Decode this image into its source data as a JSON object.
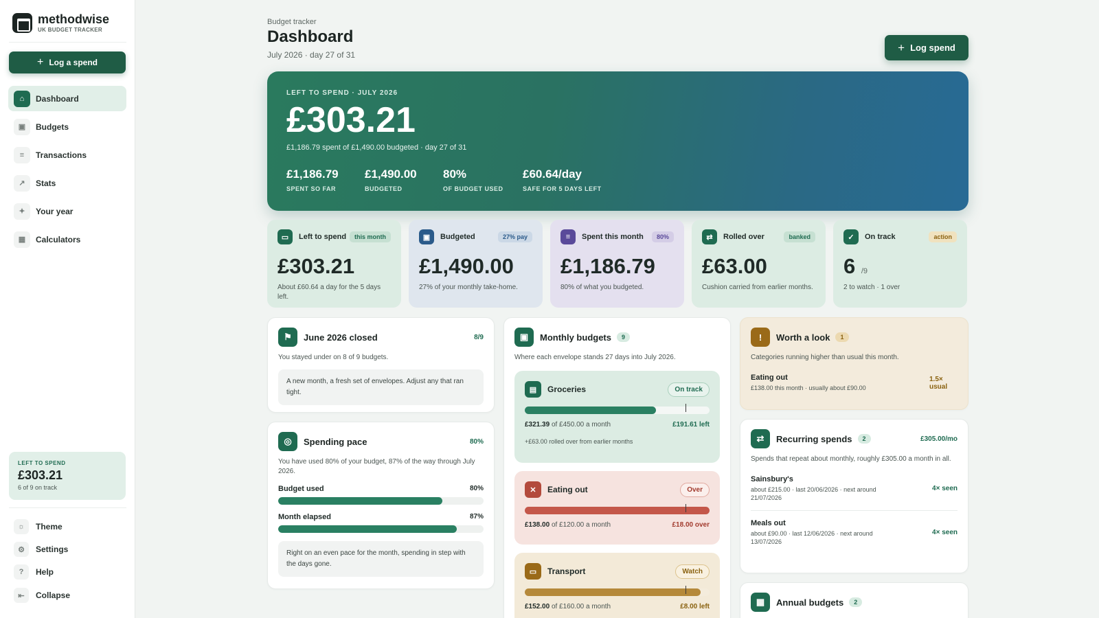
{
  "brand": {
    "name": "methodwise",
    "sub": "UK BUDGET TRACKER"
  },
  "sidebar": {
    "log_button": "Log a spend",
    "items": [
      {
        "label": "Dashboard",
        "icon": "home-icon"
      },
      {
        "label": "Budgets",
        "icon": "wallet-icon"
      },
      {
        "label": "Transactions",
        "icon": "receipt-icon"
      },
      {
        "label": "Stats",
        "icon": "trend-icon"
      },
      {
        "label": "Your year",
        "icon": "sparkle-icon"
      },
      {
        "label": "Calculators",
        "icon": "calculator-icon"
      }
    ],
    "summary": {
      "label": "LEFT TO SPEND",
      "amount": "£303.21",
      "sub": "6 of 9 on track"
    },
    "footer": [
      {
        "label": "Theme",
        "icon": "sun-icon"
      },
      {
        "label": "Settings",
        "icon": "gear-icon"
      },
      {
        "label": "Help",
        "icon": "help-icon"
      },
      {
        "label": "Collapse",
        "icon": "collapse-icon"
      }
    ]
  },
  "header": {
    "breadcrumb": "Budget tracker",
    "title": "Dashboard",
    "subtitle": "July 2026 · day 27 of 31",
    "log_button": "Log spend"
  },
  "hero": {
    "label": "LEFT TO SPEND · JULY 2026",
    "amount": "£303.21",
    "sub": "£1,186.79 spent of £1,490.00 budgeted · day 27 of 31",
    "stats": [
      {
        "value": "£1,186.79",
        "label": "SPENT SO FAR"
      },
      {
        "value": "£1,490.00",
        "label": "BUDGETED"
      },
      {
        "value": "80%",
        "label": "OF BUDGET USED"
      },
      {
        "value": "£60.64/day",
        "label": "SAFE FOR 5 DAYS LEFT"
      }
    ]
  },
  "stat_cards": [
    {
      "title": "Left to spend",
      "badge": "this month",
      "value": "£303.21",
      "unit": "",
      "desc": "About £60.64 a day for the 5 days left."
    },
    {
      "title": "Budgeted",
      "badge": "27% pay",
      "value": "£1,490.00",
      "unit": "",
      "desc": "27% of your monthly take-home."
    },
    {
      "title": "Spent this month",
      "badge": "80%",
      "value": "£1,186.79",
      "unit": "",
      "desc": "80% of what you budgeted."
    },
    {
      "title": "Rolled over",
      "badge": "banked",
      "value": "£63.00",
      "unit": "",
      "desc": "Cushion carried from earlier months."
    },
    {
      "title": "On track",
      "badge": "action",
      "value": "6",
      "unit": "/9",
      "desc": "2 to watch · 1 over"
    }
  ],
  "june": {
    "title": "June 2026 closed",
    "count": "8/9",
    "desc": "You stayed under on 8 of 9 budgets.",
    "note": "A new month, a fresh set of envelopes. Adjust any that ran tight."
  },
  "pace": {
    "title": "Spending pace",
    "percent": "80%",
    "desc": "You have used 80% of your budget, 87% of the way through July 2026.",
    "bars": [
      {
        "label": "Budget used",
        "value": "80%",
        "level": 0.8
      },
      {
        "label": "Month elapsed",
        "value": "87%",
        "level": 0.87
      }
    ],
    "note": "Right on an even pace for the month, spending in step with the days gone."
  },
  "monthly": {
    "title": "Monthly budgets",
    "count": "9",
    "desc": "Where each envelope stands 27 days into July 2026.",
    "envelopes": [
      {
        "name": "Groceries",
        "status": "On track",
        "spent": "£321.39",
        "of": "of £450.00 a month",
        "left": "£191.61 left",
        "extra": "+£63.00 rolled over from earlier months",
        "level": 0.71,
        "mark": 0.87
      },
      {
        "name": "Eating out",
        "status": "Over",
        "spent": "£138.00",
        "of": "of £120.00 a month",
        "left": "£18.00 over",
        "extra": "",
        "level": 1.0,
        "mark": 0.87
      },
      {
        "name": "Transport",
        "status": "Watch",
        "spent": "£152.00",
        "of": "of £160.00 a month",
        "left": "£8.00 left",
        "extra": "",
        "level": 0.95,
        "mark": 0.87
      }
    ]
  },
  "worth": {
    "title": "Worth a look",
    "count": "1",
    "desc": "Categories running higher than usual this month.",
    "item": {
      "name": "Eating out",
      "sub": "£138.00 this month · usually about £90.00",
      "tag": "1.5× usual"
    }
  },
  "recurring": {
    "title": "Recurring spends",
    "count": "2",
    "total": "£305.00/mo",
    "desc": "Spends that repeat about monthly, roughly £305.00 a month in all.",
    "items": [
      {
        "name": "Sainsbury's",
        "sub": "about £215.00 · last 20/06/2026 · next around 21/07/2026",
        "tag": "4× seen"
      },
      {
        "name": "Meals out",
        "sub": "about £90.00 · last 12/06/2026 · next around 13/07/2026",
        "tag": "4× seen"
      }
    ]
  },
  "annual": {
    "title": "Annual budgets",
    "count": "2"
  }
}
